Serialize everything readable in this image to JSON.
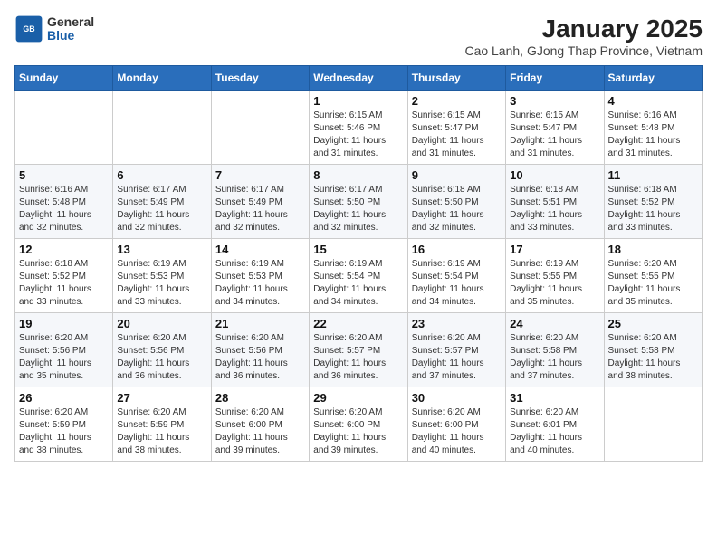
{
  "header": {
    "logo_general": "General",
    "logo_blue": "Blue",
    "month_year": "January 2025",
    "location": "Cao Lanh, GJong Thap Province, Vietnam"
  },
  "weekdays": [
    "Sunday",
    "Monday",
    "Tuesday",
    "Wednesday",
    "Thursday",
    "Friday",
    "Saturday"
  ],
  "weeks": [
    [
      {
        "day": "",
        "info": ""
      },
      {
        "day": "",
        "info": ""
      },
      {
        "day": "",
        "info": ""
      },
      {
        "day": "1",
        "info": "Sunrise: 6:15 AM\nSunset: 5:46 PM\nDaylight: 11 hours\nand 31 minutes."
      },
      {
        "day": "2",
        "info": "Sunrise: 6:15 AM\nSunset: 5:47 PM\nDaylight: 11 hours\nand 31 minutes."
      },
      {
        "day": "3",
        "info": "Sunrise: 6:15 AM\nSunset: 5:47 PM\nDaylight: 11 hours\nand 31 minutes."
      },
      {
        "day": "4",
        "info": "Sunrise: 6:16 AM\nSunset: 5:48 PM\nDaylight: 11 hours\nand 31 minutes."
      }
    ],
    [
      {
        "day": "5",
        "info": "Sunrise: 6:16 AM\nSunset: 5:48 PM\nDaylight: 11 hours\nand 32 minutes."
      },
      {
        "day": "6",
        "info": "Sunrise: 6:17 AM\nSunset: 5:49 PM\nDaylight: 11 hours\nand 32 minutes."
      },
      {
        "day": "7",
        "info": "Sunrise: 6:17 AM\nSunset: 5:49 PM\nDaylight: 11 hours\nand 32 minutes."
      },
      {
        "day": "8",
        "info": "Sunrise: 6:17 AM\nSunset: 5:50 PM\nDaylight: 11 hours\nand 32 minutes."
      },
      {
        "day": "9",
        "info": "Sunrise: 6:18 AM\nSunset: 5:50 PM\nDaylight: 11 hours\nand 32 minutes."
      },
      {
        "day": "10",
        "info": "Sunrise: 6:18 AM\nSunset: 5:51 PM\nDaylight: 11 hours\nand 33 minutes."
      },
      {
        "day": "11",
        "info": "Sunrise: 6:18 AM\nSunset: 5:52 PM\nDaylight: 11 hours\nand 33 minutes."
      }
    ],
    [
      {
        "day": "12",
        "info": "Sunrise: 6:18 AM\nSunset: 5:52 PM\nDaylight: 11 hours\nand 33 minutes."
      },
      {
        "day": "13",
        "info": "Sunrise: 6:19 AM\nSunset: 5:53 PM\nDaylight: 11 hours\nand 33 minutes."
      },
      {
        "day": "14",
        "info": "Sunrise: 6:19 AM\nSunset: 5:53 PM\nDaylight: 11 hours\nand 34 minutes."
      },
      {
        "day": "15",
        "info": "Sunrise: 6:19 AM\nSunset: 5:54 PM\nDaylight: 11 hours\nand 34 minutes."
      },
      {
        "day": "16",
        "info": "Sunrise: 6:19 AM\nSunset: 5:54 PM\nDaylight: 11 hours\nand 34 minutes."
      },
      {
        "day": "17",
        "info": "Sunrise: 6:19 AM\nSunset: 5:55 PM\nDaylight: 11 hours\nand 35 minutes."
      },
      {
        "day": "18",
        "info": "Sunrise: 6:20 AM\nSunset: 5:55 PM\nDaylight: 11 hours\nand 35 minutes."
      }
    ],
    [
      {
        "day": "19",
        "info": "Sunrise: 6:20 AM\nSunset: 5:56 PM\nDaylight: 11 hours\nand 35 minutes."
      },
      {
        "day": "20",
        "info": "Sunrise: 6:20 AM\nSunset: 5:56 PM\nDaylight: 11 hours\nand 36 minutes."
      },
      {
        "day": "21",
        "info": "Sunrise: 6:20 AM\nSunset: 5:56 PM\nDaylight: 11 hours\nand 36 minutes."
      },
      {
        "day": "22",
        "info": "Sunrise: 6:20 AM\nSunset: 5:57 PM\nDaylight: 11 hours\nand 36 minutes."
      },
      {
        "day": "23",
        "info": "Sunrise: 6:20 AM\nSunset: 5:57 PM\nDaylight: 11 hours\nand 37 minutes."
      },
      {
        "day": "24",
        "info": "Sunrise: 6:20 AM\nSunset: 5:58 PM\nDaylight: 11 hours\nand 37 minutes."
      },
      {
        "day": "25",
        "info": "Sunrise: 6:20 AM\nSunset: 5:58 PM\nDaylight: 11 hours\nand 38 minutes."
      }
    ],
    [
      {
        "day": "26",
        "info": "Sunrise: 6:20 AM\nSunset: 5:59 PM\nDaylight: 11 hours\nand 38 minutes."
      },
      {
        "day": "27",
        "info": "Sunrise: 6:20 AM\nSunset: 5:59 PM\nDaylight: 11 hours\nand 38 minutes."
      },
      {
        "day": "28",
        "info": "Sunrise: 6:20 AM\nSunset: 6:00 PM\nDaylight: 11 hours\nand 39 minutes."
      },
      {
        "day": "29",
        "info": "Sunrise: 6:20 AM\nSunset: 6:00 PM\nDaylight: 11 hours\nand 39 minutes."
      },
      {
        "day": "30",
        "info": "Sunrise: 6:20 AM\nSunset: 6:00 PM\nDaylight: 11 hours\nand 40 minutes."
      },
      {
        "day": "31",
        "info": "Sunrise: 6:20 AM\nSunset: 6:01 PM\nDaylight: 11 hours\nand 40 minutes."
      },
      {
        "day": "",
        "info": ""
      }
    ]
  ]
}
